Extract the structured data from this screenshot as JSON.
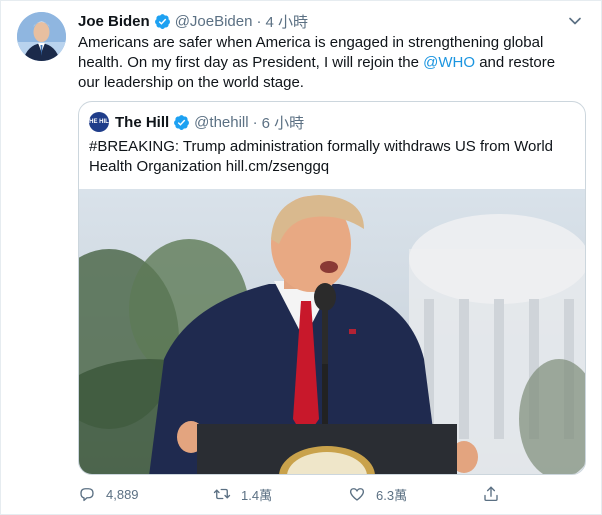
{
  "author": {
    "name": "Joe Biden",
    "handle": "@JoeBiden",
    "separator": "·",
    "time": "4 小時",
    "avatar_icon": "user-avatar-photo",
    "verified_icon": "verified-badge-icon"
  },
  "tweet": {
    "line1": "Americans are safer when America is engaged in strengthening global",
    "line2": "health. On my first day as President, I will rejoin the ",
    "mention": "@WHO",
    "line2_end": " and restore",
    "line3": "our leadership on the world stage."
  },
  "quoted": {
    "avatar_text": "THE HILL",
    "name": "The Hill",
    "handle": "@thehill",
    "separator": "·",
    "time": "6 小時",
    "line1": "#BREAKING: Trump administration formally withdraws US from World",
    "line2": "Health Organization hill.cm/zsenggq",
    "image_icon": "speaker-at-podium-photo"
  },
  "actions": {
    "reply_count": "4,889",
    "retweet_count": "1.4萬",
    "like_count": "6.3萬",
    "reply_icon": "reply-icon",
    "retweet_icon": "retweet-icon",
    "like_icon": "heart-icon",
    "share_icon": "share-icon"
  },
  "colors": {
    "link": "#1b95e0",
    "verified": "#1da1f2",
    "muted": "#5b7083",
    "border": "#ccd6dd"
  }
}
